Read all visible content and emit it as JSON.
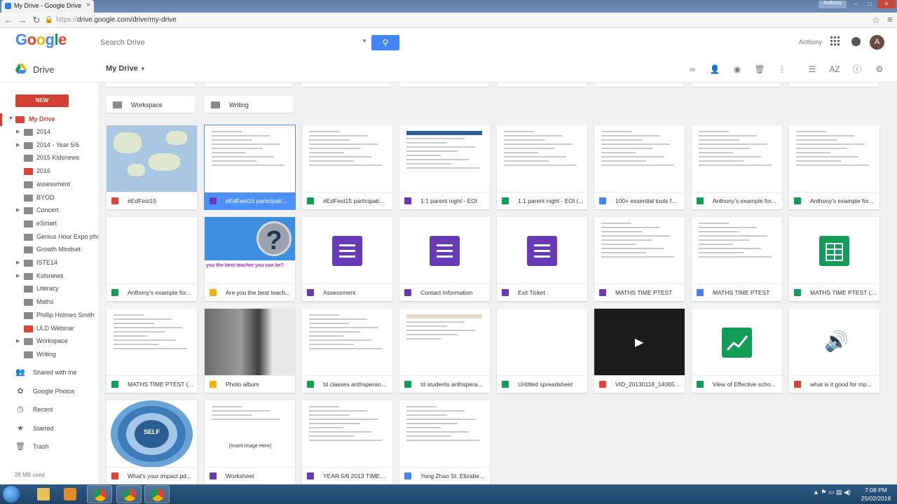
{
  "browser": {
    "tab_title": "My Drive - Google Drive",
    "tab_close": "×",
    "user_chip": "Anthony",
    "url_scheme": "https://",
    "url_rest": "drive.google.com/drive/my-drive"
  },
  "header": {
    "logo": "Google",
    "search_placeholder": "Search Drive",
    "account_name": "Anthony",
    "avatar_letter": "A"
  },
  "toolbar": {
    "app_name": "Drive",
    "location": "My Drive"
  },
  "sidebar": {
    "new_label": "NEW",
    "root_label": "My Drive",
    "folders": [
      {
        "label": "2014",
        "color": "gray",
        "arrow": true
      },
      {
        "label": "2014 - Year 5/6",
        "color": "gray",
        "arrow": true
      },
      {
        "label": "2015 Kidsnews",
        "color": "gray",
        "arrow": false
      },
      {
        "label": "2016",
        "color": "red",
        "arrow": false
      },
      {
        "label": "assessment",
        "color": "gray",
        "arrow": false
      },
      {
        "label": "BYOD",
        "color": "gray",
        "arrow": false
      },
      {
        "label": "Concert",
        "color": "gray",
        "arrow": true
      },
      {
        "label": "eSmart",
        "color": "gray",
        "arrow": false
      },
      {
        "label": "Genius Hour Expo pho",
        "color": "gray",
        "arrow": false
      },
      {
        "label": "Growth Mindset",
        "color": "gray",
        "arrow": false
      },
      {
        "label": "ISTE14",
        "color": "gray",
        "arrow": true
      },
      {
        "label": "Kidsnews",
        "color": "gray",
        "arrow": true
      },
      {
        "label": "Literacy",
        "color": "gray",
        "arrow": false
      },
      {
        "label": "Maths",
        "color": "gray",
        "arrow": false
      },
      {
        "label": "Phillip Holmes Smith",
        "color": "gray",
        "arrow": false
      },
      {
        "label": "ULD Webinar",
        "color": "red",
        "arrow": false
      },
      {
        "label": "Workspace",
        "color": "gray",
        "arrow": true
      },
      {
        "label": "Writing",
        "color": "gray",
        "arrow": false
      }
    ],
    "links": [
      {
        "label": "Shared with me",
        "icon": "people-icon"
      },
      {
        "label": "Google Photos",
        "icon": "photos-icon"
      },
      {
        "label": "Recent",
        "icon": "clock-icon"
      },
      {
        "label": "Starred",
        "icon": "star-icon"
      },
      {
        "label": "Trash",
        "icon": "trash-icon"
      }
    ],
    "storage": "28 MB used"
  },
  "content": {
    "folders": [
      "Workspace",
      "Writing"
    ],
    "files": [
      {
        "label": "#EdFest15",
        "type": "map"
      },
      {
        "label": "#EdFest15 participati...",
        "type": "form",
        "selected": true
      },
      {
        "label": "#EdFest15 participati...",
        "type": "sheet"
      },
      {
        "label": "1:1 parent night - EOI",
        "type": "form"
      },
      {
        "label": "1:1 parent night - EOI (...",
        "type": "sheet"
      },
      {
        "label": "100+ essential tools f...",
        "type": "doc"
      },
      {
        "label": "Anthony's example for...",
        "type": "sheet"
      },
      {
        "label": "Anthony's example for...",
        "type": "sheet"
      },
      {
        "label": "Anthony's example for...",
        "type": "sheet"
      },
      {
        "label": "Are you the best teach...",
        "type": "slides"
      },
      {
        "label": "Assessment",
        "type": "form"
      },
      {
        "label": "Contact Information",
        "type": "form"
      },
      {
        "label": "Exit Ticket",
        "type": "form"
      },
      {
        "label": "MATHS TIME PTEST",
        "type": "form"
      },
      {
        "label": "MATHS TIME PTEST",
        "type": "doc"
      },
      {
        "label": "MATHS TIME PTEST (...",
        "type": "sheet"
      },
      {
        "label": "MATHS TIME PTEST (...",
        "type": "sheet"
      },
      {
        "label": "Photo album",
        "type": "slides"
      },
      {
        "label": "td classes anthsperan...",
        "type": "sheet"
      },
      {
        "label": "td students anthspera...",
        "type": "sheet"
      },
      {
        "label": "Untitled spreadsheet",
        "type": "sheet"
      },
      {
        "label": "VID_20130118_14065...",
        "type": "video"
      },
      {
        "label": "View of Effective scho...",
        "type": "chart"
      },
      {
        "label": "what is it good for mp...",
        "type": "audio"
      },
      {
        "label": "What's your impact.pd...",
        "type": "pdf"
      },
      {
        "label": "Worksheet",
        "type": "form"
      },
      {
        "label": "YEAR 5/6 2013 TIME...",
        "type": "form"
      },
      {
        "label": "Yong Zhao St. Elizabe...",
        "type": "doc"
      }
    ],
    "thumb_texts": {
      "poster_caption": "you the best teacher you can be?",
      "self_center": "SELF",
      "worksheet_placeholder": "[Insert Image Here]",
      "question_mark": "?"
    }
  },
  "taskbar": {
    "time": "7:08 PM",
    "date": "25/02/2016"
  }
}
